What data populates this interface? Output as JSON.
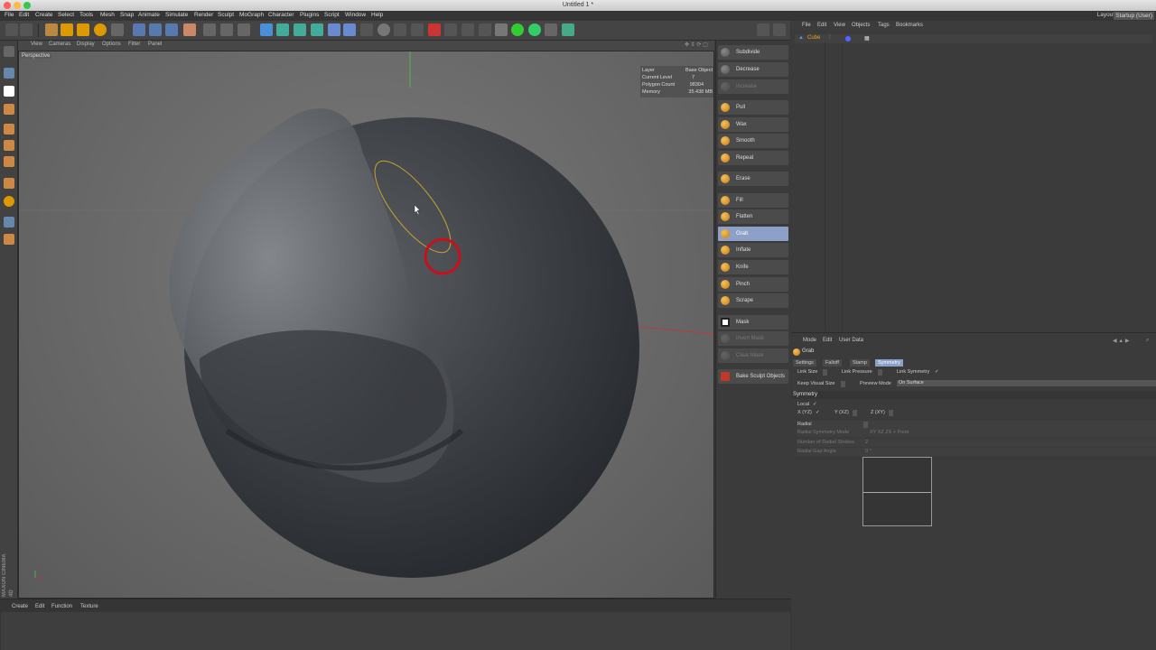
{
  "window": {
    "title": "Untitled 1 *"
  },
  "menubar": {
    "items": [
      "File",
      "Edit",
      "Create",
      "Select",
      "Tools",
      "Mesh",
      "Snap",
      "Animate",
      "Simulate",
      "Render",
      "Sculpt",
      "MoGraph",
      "Character",
      "Plugins",
      "Script",
      "Window",
      "Help"
    ],
    "layout_label": "Layout:",
    "layout_value": "Startup (User)"
  },
  "viewport": {
    "menu": [
      "View",
      "Cameras",
      "Display",
      "Options",
      "Filter",
      "Panel"
    ],
    "camera_label": "Perspective",
    "hud": {
      "layer_label": "Layer",
      "layer_value": "Base Object",
      "level_label": "Current Level",
      "level_value": "7",
      "poly_label": "Polygon Count",
      "poly_value": "98304",
      "memory_label": "Memory",
      "memory_value": "35.438 MB"
    },
    "brand": "MAXON CINEMA 4D"
  },
  "sculpt_tools": {
    "subdivide": "Subdivide",
    "decrease": "Decrease",
    "increase": "Increase",
    "pull": "Pull",
    "wax": "Wax",
    "smooth": "Smooth",
    "repeat": "Repeat",
    "erase": "Erase",
    "fill": "Fill",
    "flatten": "Flatten",
    "grab": "Grab",
    "inflate": "Inflate",
    "knife": "Knife",
    "pinch": "Pinch",
    "scrape": "Scrape",
    "mask": "Mask",
    "invert_mask": "Invert Mask",
    "clear_mask": "Clear Mask",
    "bake": "Bake Sculpt Objects"
  },
  "object_manager": {
    "menu": [
      "File",
      "Edit",
      "View",
      "Objects",
      "Tags",
      "Bookmarks"
    ],
    "object_name": "Cube"
  },
  "attribute_manager": {
    "menu": [
      "Mode",
      "Edit",
      "User Data"
    ],
    "title": "Grab",
    "tabs": [
      "Settings",
      "Falloff",
      "Stamp",
      "Symmetry"
    ],
    "link_size": "Link Size",
    "link_pressure": "Link Pressure",
    "link_symmetry": "Link Symmetry",
    "link_symmetry_check": "✓",
    "keep_visual_size": "Keep Visual Size",
    "preview_mode_label": "Preview Mode",
    "preview_mode_value": "On Surface",
    "symmetry_header": "Symmetry",
    "local": "Local",
    "local_check": "✓",
    "x_yz": "X (YZ)",
    "x_yz_check": "✓",
    "y_xz": "Y (XZ)",
    "z_xy": "Z (XY)",
    "radial": "Radial",
    "radial_mode": "Radial Symmetry Mode",
    "radial_mode_options": "XY   XZ   ZX + Point",
    "radial_strokes": "Number of Radial Strokes",
    "radial_strokes_value": "2",
    "radial_gap": "Radial Gap Angle",
    "radial_gap_value": "0 °"
  },
  "bottom": {
    "menu": [
      "Create",
      "Edit",
      "Function",
      "Texture"
    ]
  }
}
